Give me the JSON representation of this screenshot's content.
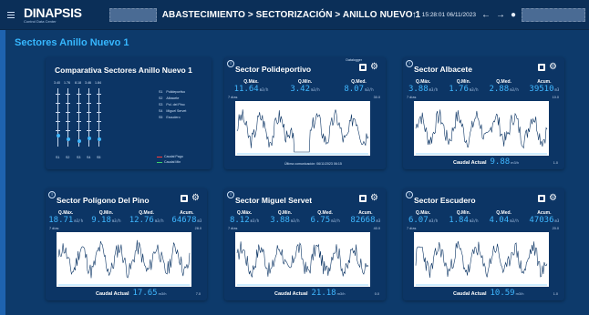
{
  "header": {
    "logo": "DINAPSIS",
    "logo_sub": "Control Data Center",
    "breadcrumb": "ABASTECIMIENTO > SECTORIZACIÓN > ANILLO NUEVO 1",
    "timestamp": "15:28:01 06/11/2023"
  },
  "page_title": "Sectores Anillo Nuevo 1",
  "comparison": {
    "title": "Comparativa Sectores Anillo Nuevo 1",
    "top_values": [
      "3.40",
      "1.76",
      "8.18",
      "3.46",
      "1.84"
    ],
    "slider_labels": [
      "S1",
      "S2",
      "S3",
      "S4",
      "S5"
    ],
    "legend": [
      {
        "code": "S1",
        "name": "Polideportivo"
      },
      {
        "code": "S2",
        "name": "Albacete"
      },
      {
        "code": "S3",
        "name": "Pol. del Pino"
      },
      {
        "code": "S4",
        "name": "Miguel Servet"
      },
      {
        "code": "S5",
        "name": "Escudero"
      }
    ],
    "bottom_legend": [
      "Caudal Pago",
      "Caudal Min"
    ],
    "slider_levels": [
      0.82,
      0.88,
      0.9,
      0.86,
      0.88
    ],
    "colors": {
      "accent": "#3fb7ff",
      "legend_red": "#ff3b3b",
      "legend_green": "#3cd16a"
    }
  },
  "labels": {
    "max": "Q.Máx.",
    "min": "Q.Mín.",
    "med": "Q.Med.",
    "acum": "Acum.",
    "caudal_actual": "Caudal Actual"
  },
  "sectors": [
    {
      "title": "Sector Polideportivo",
      "top_note": "Datalogger",
      "q_max": "11.64",
      "q_min": "3.42",
      "q_med": "8.07",
      "acum": "",
      "unit": "m3/h",
      "y_label": "7 días",
      "y_top": "30.0",
      "footer": "Última comunicación: 06/11/2023 06:15",
      "caudal_actual": "",
      "x_right": ""
    },
    {
      "title": "Sector Albacete",
      "top_note": "",
      "q_max": "3.88",
      "q_min": "1.76",
      "q_med": "2.88",
      "acum": "39510",
      "unit": "m3/h",
      "acum_unit": "m3",
      "y_label": "7 días",
      "y_top": "10.0",
      "footer": "",
      "caudal_actual": "9.88",
      "x_right": "1.0"
    },
    {
      "title": "Sector Polígono Del Pino",
      "top_note": "",
      "q_max": "18.71",
      "q_min": "9.18",
      "q_med": "12.76",
      "acum": "64678",
      "unit": "m3/h",
      "acum_unit": "m3",
      "y_label": "7 días",
      "y_top": "28.0",
      "footer": "",
      "caudal_actual": "17.65",
      "x_right": "7.0"
    },
    {
      "title": "Sector Miguel Servet",
      "top_note": "",
      "q_max": "8.12",
      "q_min": "3.88",
      "q_med": "6.75",
      "acum": "82668",
      "unit": "m3/h",
      "acum_unit": "m3",
      "y_label": "7 días",
      "y_top": "40.0",
      "footer": "",
      "caudal_actual": "21.18",
      "x_right": "0.0"
    },
    {
      "title": "Sector Escudero",
      "top_note": "",
      "q_max": "6.07",
      "q_min": "1.84",
      "q_med": "4.04",
      "acum": "47036",
      "unit": "m3/h",
      "acum_unit": "m3",
      "y_label": "7 días",
      "y_top": "20.0",
      "footer": "",
      "caudal_actual": "10.59",
      "x_right": "1.0"
    }
  ],
  "icons": [
    "menu-icon",
    "arrow-up-icon",
    "back-icon",
    "forward-icon",
    "user-icon",
    "info-icon",
    "export-icon",
    "gear-icon"
  ]
}
